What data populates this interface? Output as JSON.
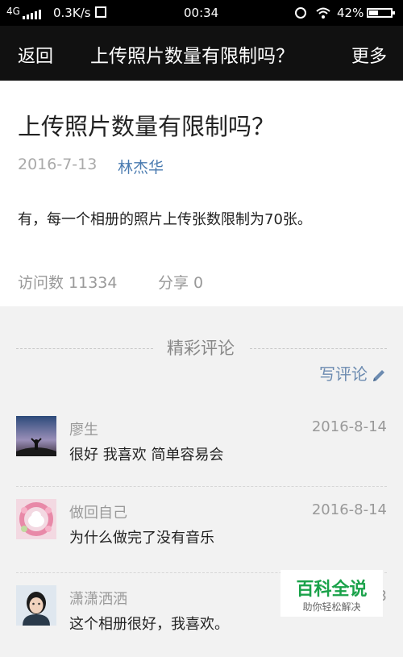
{
  "status_bar": {
    "network": "4G",
    "speed": "0.3K/s",
    "time": "00:34",
    "battery_percent": "42%",
    "battery_level": 0.42
  },
  "nav": {
    "back_label": "返回",
    "title": "上传照片数量有限制吗？",
    "more_label": "更多"
  },
  "article": {
    "title": "上传照片数量有限制吗？",
    "date": "2016-7-13",
    "author": "林杰华",
    "body": "有，每一个相册的照片上传张数限制为70张。",
    "visits": "访问数 11334",
    "shares": "分享 0"
  },
  "comments_section": {
    "title": "精彩评论",
    "write_label": "写评论"
  },
  "comments": [
    {
      "name": "廖生",
      "date": "2016-8-14",
      "text": "很好 我喜欢 简单容易会"
    },
    {
      "name": "做回自己",
      "date": "2016-8-14",
      "text": "为什么做完了没有音乐"
    },
    {
      "name": "潇潇洒洒",
      "date": "2016-8-13",
      "text": "这个相册很好，我喜欢。"
    }
  ],
  "watermark": {
    "title": "百科全说",
    "subtitle": "助你轻松解决"
  },
  "colors": {
    "nav_bg": "#111111",
    "author_link": "#4a7bb0",
    "brand_green": "#1aa24a"
  }
}
